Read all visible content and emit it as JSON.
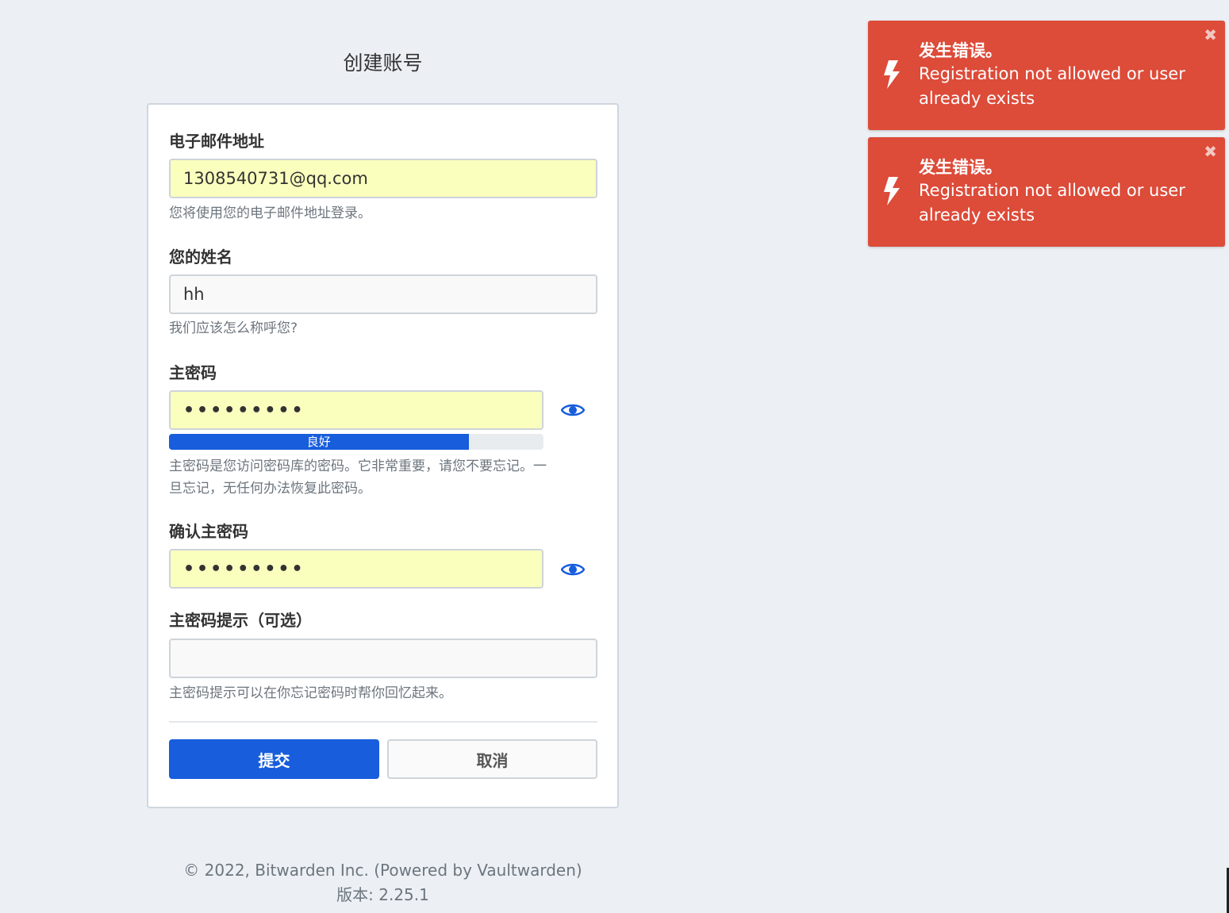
{
  "page": {
    "title": "创建账号"
  },
  "form": {
    "email": {
      "label": "电子邮件地址",
      "value": "1308540731@qq.com",
      "help": "您将使用您的电子邮件地址登录。"
    },
    "name": {
      "label": "您的姓名",
      "value": "hh",
      "help": "我们应该怎么称呼您?"
    },
    "master_password": {
      "label": "主密码",
      "value": "•••••••••",
      "strength_label": "良好",
      "strength_fraction": 0.8,
      "help_line1": "主密码是您访问密码库的密码。它非常重要，请您不要忘记。一",
      "help_line2": "旦忘记，无任何办法恢复此密码。"
    },
    "confirm_password": {
      "label": "确认主密码",
      "value": "•••••••••"
    },
    "hint": {
      "label": "主密码提示（可选）",
      "value": "",
      "help": "主密码提示可以在你忘记密码时帮你回忆起来。"
    },
    "submit_label": "提交",
    "cancel_label": "取消"
  },
  "footer": {
    "copyright": "© 2022, Bitwarden Inc. (Powered by Vaultwarden)",
    "version": "版本: 2.25.1"
  },
  "toasts": [
    {
      "title": "发生错误。",
      "message": "Registration not allowed or user already exists",
      "close": "✖"
    },
    {
      "title": "发生错误。",
      "message": "Registration not allowed or user already exists",
      "close": "✖"
    }
  ],
  "colors": {
    "primary": "#175ddc",
    "error": "#dd4b39",
    "autofill": "#faffbd",
    "background": "#ecf0f5"
  },
  "icons": {
    "toggle_visibility": "eye-icon",
    "toast": "bolt-icon",
    "close": "close-icon"
  }
}
